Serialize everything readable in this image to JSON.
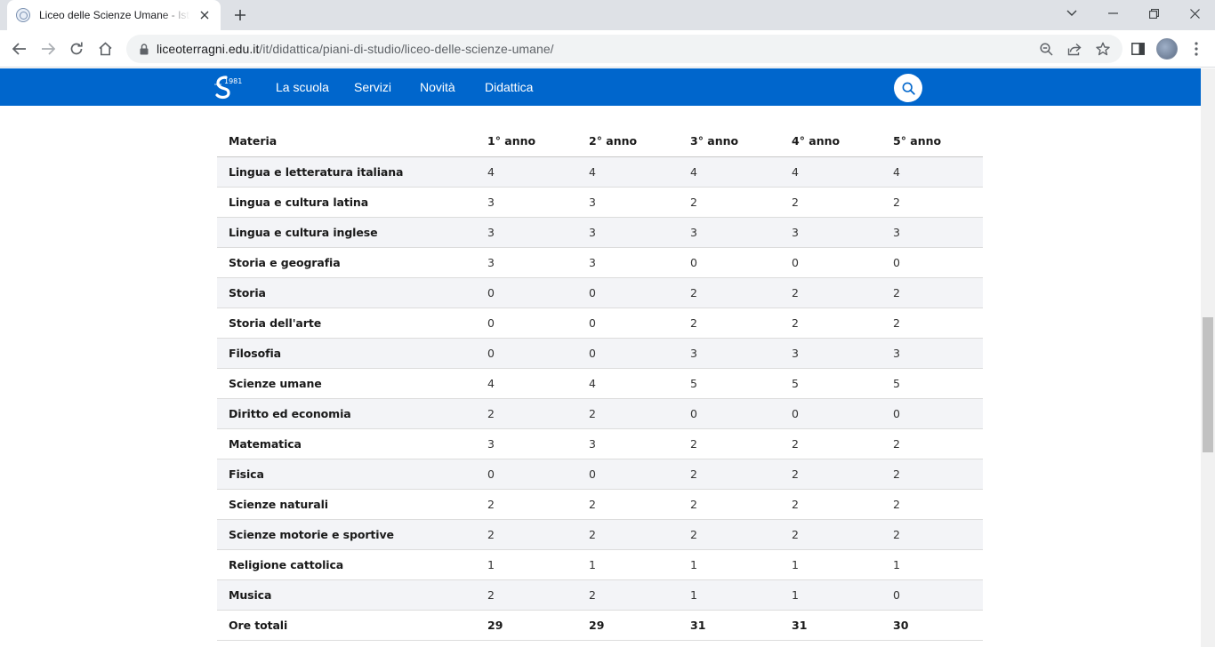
{
  "browser": {
    "tab_title": "Liceo delle Scienze Umane - Istituto",
    "url_host": "liceoterragni.edu.it",
    "url_path": "/it/didattica/piani-di-studio/liceo-delle-scienze-umane/"
  },
  "site": {
    "logo_text": "1981",
    "nav": [
      "La scuola",
      "Servizi",
      "Novità",
      "Didattica"
    ],
    "brand_color": "#0066cc"
  },
  "table": {
    "headers": [
      "Materia",
      "1° anno",
      "2° anno",
      "3° anno",
      "4° anno",
      "5° anno"
    ],
    "rows": [
      [
        "Lingua e letteratura italiana",
        "4",
        "4",
        "4",
        "4",
        "4"
      ],
      [
        "Lingua e cultura latina",
        "3",
        "3",
        "2",
        "2",
        "2"
      ],
      [
        "Lingua e cultura inglese",
        "3",
        "3",
        "3",
        "3",
        "3"
      ],
      [
        "Storia e geografia",
        "3",
        "3",
        "0",
        "0",
        "0"
      ],
      [
        "Storia",
        "0",
        "0",
        "2",
        "2",
        "2"
      ],
      [
        "Storia dell'arte",
        "0",
        "0",
        "2",
        "2",
        "2"
      ],
      [
        "Filosofia",
        "0",
        "0",
        "3",
        "3",
        "3"
      ],
      [
        "Scienze umane",
        "4",
        "4",
        "5",
        "5",
        "5"
      ],
      [
        "Diritto ed economia",
        "2",
        "2",
        "0",
        "0",
        "0"
      ],
      [
        "Matematica",
        "3",
        "3",
        "2",
        "2",
        "2"
      ],
      [
        "Fisica",
        "0",
        "0",
        "2",
        "2",
        "2"
      ],
      [
        "Scienze naturali",
        "2",
        "2",
        "2",
        "2",
        "2"
      ],
      [
        "Scienze motorie e sportive",
        "2",
        "2",
        "2",
        "2",
        "2"
      ],
      [
        "Religione cattolica",
        "1",
        "1",
        "1",
        "1",
        "1"
      ],
      [
        "Musica",
        "2",
        "2",
        "1",
        "1",
        "0"
      ]
    ],
    "total": [
      "Ore totali",
      "29",
      "29",
      "31",
      "31",
      "30"
    ]
  }
}
